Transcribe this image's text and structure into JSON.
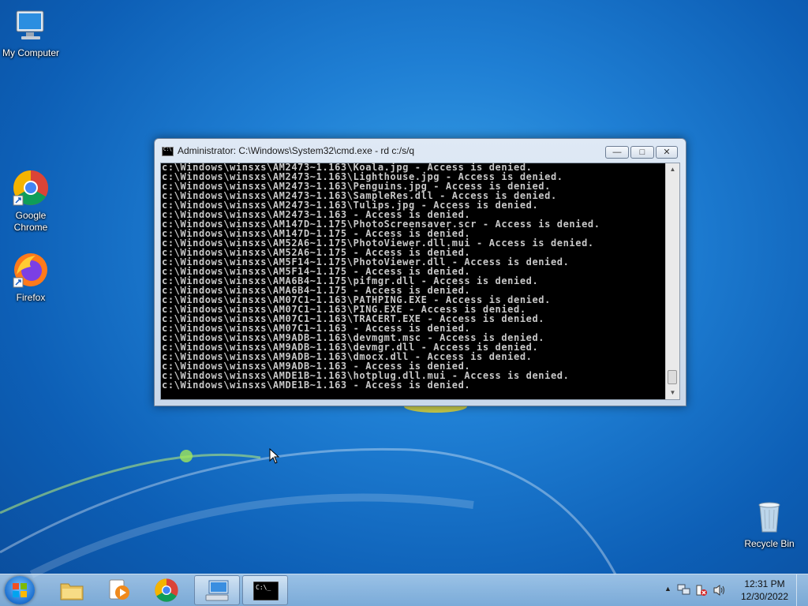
{
  "desktop": {
    "icons": [
      {
        "label": "My Computer"
      },
      {
        "label": "Google Chrome"
      },
      {
        "label": "Firefox"
      },
      {
        "label": "Recycle Bin"
      }
    ]
  },
  "window": {
    "title": "Administrator: C:\\Windows\\System32\\cmd.exe - rd  c:/s/q",
    "minimize_glyph": "—",
    "maximize_glyph": "□",
    "close_glyph": "✕",
    "lines": [
      "c:\\Windows\\winsxs\\AM2473~1.163\\Koala.jpg - Access is denied.",
      "c:\\Windows\\winsxs\\AM2473~1.163\\Lighthouse.jpg - Access is denied.",
      "c:\\Windows\\winsxs\\AM2473~1.163\\Penguins.jpg - Access is denied.",
      "c:\\Windows\\winsxs\\AM2473~1.163\\SampleRes.dll - Access is denied.",
      "c:\\Windows\\winsxs\\AM2473~1.163\\Tulips.jpg - Access is denied.",
      "c:\\Windows\\winsxs\\AM2473~1.163 - Access is denied.",
      "c:\\Windows\\winsxs\\AM147D~1.175\\PhotoScreensaver.scr - Access is denied.",
      "c:\\Windows\\winsxs\\AM147D~1.175 - Access is denied.",
      "c:\\Windows\\winsxs\\AM52A6~1.175\\PhotoViewer.dll.mui - Access is denied.",
      "c:\\Windows\\winsxs\\AM52A6~1.175 - Access is denied.",
      "c:\\Windows\\winsxs\\AM5F14~1.175\\PhotoViewer.dll - Access is denied.",
      "c:\\Windows\\winsxs\\AM5F14~1.175 - Access is denied.",
      "c:\\Windows\\winsxs\\AMA6B4~1.175\\pifmgr.dll - Access is denied.",
      "c:\\Windows\\winsxs\\AMA6B4~1.175 - Access is denied.",
      "c:\\Windows\\winsxs\\AM07C1~1.163\\PATHPING.EXE - Access is denied.",
      "c:\\Windows\\winsxs\\AM07C1~1.163\\PING.EXE - Access is denied.",
      "c:\\Windows\\winsxs\\AM07C1~1.163\\TRACERT.EXE - Access is denied.",
      "c:\\Windows\\winsxs\\AM07C1~1.163 - Access is denied.",
      "c:\\Windows\\winsxs\\AM9ADB~1.163\\devmgmt.msc - Access is denied.",
      "c:\\Windows\\winsxs\\AM9ADB~1.163\\devmgr.dll - Access is denied.",
      "c:\\Windows\\winsxs\\AM9ADB~1.163\\dmocx.dll - Access is denied.",
      "c:\\Windows\\winsxs\\AM9ADB~1.163 - Access is denied.",
      "c:\\Windows\\winsxs\\AMDE1B~1.163\\hotplug.dll.mui - Access is denied.",
      "c:\\Windows\\winsxs\\AMDE1B~1.163 - Access is denied."
    ]
  },
  "taskbar": {
    "items": [
      {
        "icon": "file-explorer-icon"
      },
      {
        "icon": "media-player-icon"
      },
      {
        "icon": "chrome-icon"
      },
      {
        "icon": "control-panel-icon"
      },
      {
        "icon": "cmd-icon"
      }
    ],
    "clock": {
      "time": "12:31 PM",
      "date": "12/30/2022"
    }
  },
  "colors": {
    "console_bg": "#000000",
    "console_text": "#c8c8c8",
    "taskbar": "#b4d2ea"
  }
}
